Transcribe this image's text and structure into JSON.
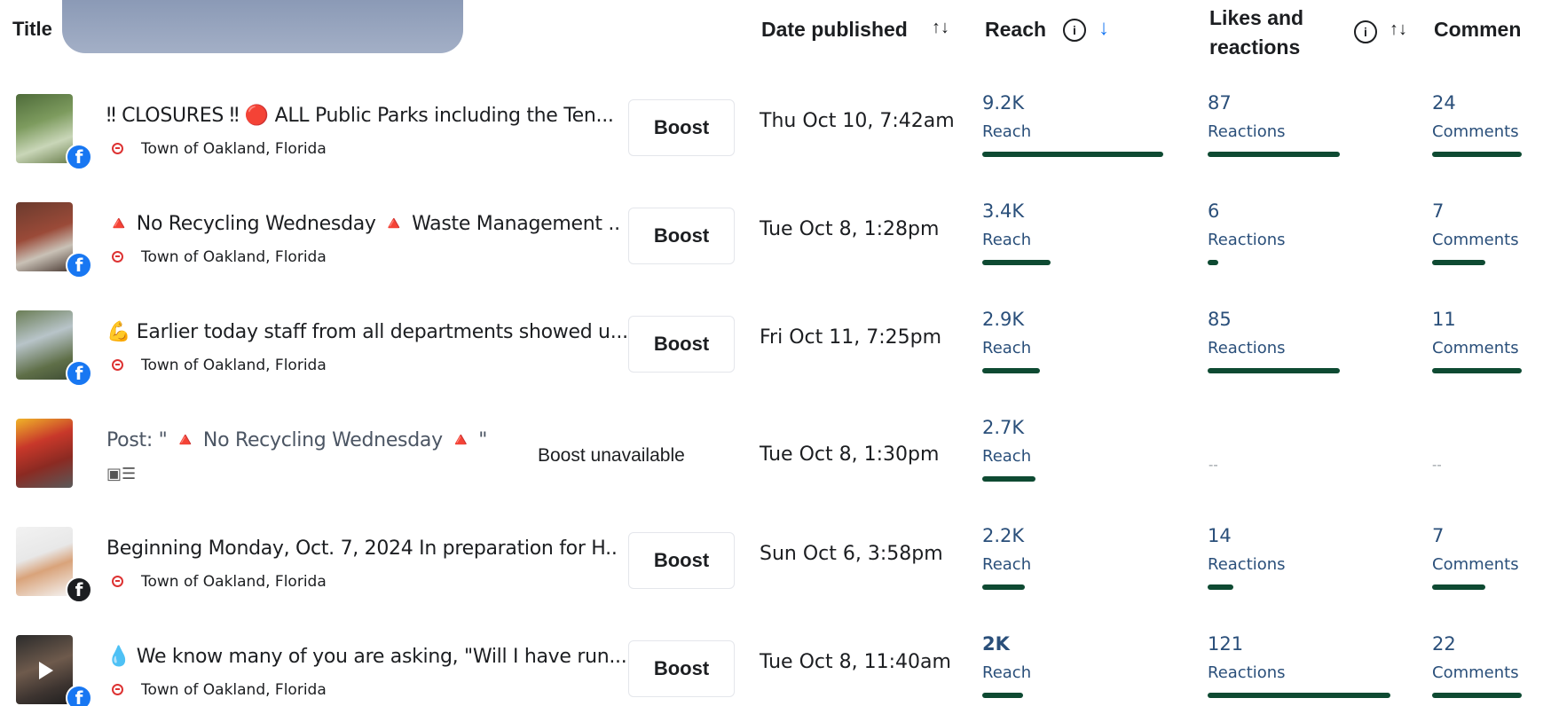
{
  "header": {
    "title": "Title",
    "date": "Date published",
    "reach": "Reach",
    "likes": "Likes and reactions",
    "comments": "Commen",
    "sort_glyph": "↑↓",
    "down_glyph": "↓",
    "info_glyph": "i"
  },
  "colors": {
    "bar": "#0e4a32",
    "metric_text": "#2a4f7a",
    "facebook": "#1877f2",
    "redaction": "#94a3bd"
  },
  "rows": [
    {
      "text": "‼ CLOSURES ‼ 🔴 ALL Public Parks including the Ten...",
      "page": "Town of Oakland, Florida",
      "boost": "Boost",
      "date": "Thu Oct 10, 7:42am",
      "reach": "9.2K",
      "reach_label": "Reach",
      "reach_level": 0.85,
      "reactions": "87",
      "reactions_label": "Reactions",
      "reactions_level": 0.62,
      "comments": "24",
      "comments_label": "Comments",
      "comments_level": 0.42
    },
    {
      "text": "🔺 No Recycling Wednesday 🔺 Waste Management ..",
      "page": "Town of Oakland, Florida",
      "boost": "Boost",
      "date": "Tue Oct 8, 1:28pm",
      "reach": "3.4K",
      "reach_label": "Reach",
      "reach_level": 0.32,
      "reactions": "6",
      "reactions_label": "Reactions",
      "reactions_level": 0.05,
      "comments": "7",
      "comments_label": "Comments",
      "comments_level": 0.25
    },
    {
      "text": "💪 Earlier today staff from all departments showed u...",
      "page": "Town of Oakland, Florida",
      "boost": "Boost",
      "date": "Fri Oct 11, 7:25pm",
      "reach": "2.9K",
      "reach_label": "Reach",
      "reach_level": 0.27,
      "reactions": "85",
      "reactions_label": "Reactions",
      "reactions_level": 0.62,
      "comments": "11",
      "comments_label": "Comments",
      "comments_level": 0.42
    },
    {
      "text": "Post: \" 🔺 No Recycling Wednesday 🔺 \"",
      "boost_unavailable": "Boost unavailable",
      "date": "Tue Oct 8, 1:30pm",
      "reach": "2.7K",
      "reach_label": "Reach",
      "reach_level": 0.25,
      "reactions_empty": "--",
      "comments_empty": "--"
    },
    {
      "text": "Beginning Monday, Oct. 7, 2024 In preparation for H..",
      "page": "Town of Oakland, Florida",
      "boost": "Boost",
      "date": "Sun Oct 6, 3:58pm",
      "reach": "2.2K",
      "reach_label": "Reach",
      "reach_level": 0.2,
      "reactions": "14",
      "reactions_label": "Reactions",
      "reactions_level": 0.12,
      "comments": "7",
      "comments_label": "Comments",
      "comments_level": 0.25
    },
    {
      "text": "💧 We know many of you are asking, \"Will I have run...",
      "page": "Town of Oakland, Florida",
      "boost": "Boost",
      "date": "Tue Oct 8, 11:40am",
      "reach": "2K",
      "reach_label": "Reach",
      "reach_level": 0.19,
      "reactions": "121",
      "reactions_label": "Reactions",
      "reactions_level": 0.86,
      "comments": "22",
      "comments_label": "Comments",
      "comments_level": 0.42
    }
  ]
}
